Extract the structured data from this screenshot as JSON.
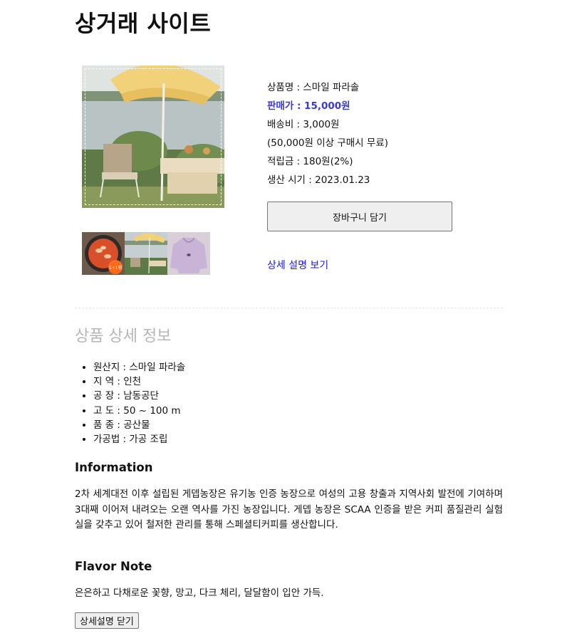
{
  "site": {
    "title": "상거래 사이트"
  },
  "product": {
    "name_line": "상품명 : 스마일 파라솔",
    "price_line": "판매가 : 15,000원",
    "shipping_line": "배송비 : 3,000원",
    "shipping_note": "(50,000원 이상 구매시 무료)",
    "points_line": "적립금 : 180원(2%)",
    "produced_line": "생산 시기 : 2023.01.23",
    "main_image": "parasol-photo",
    "thumbnails": [
      {
        "image": "tteokbokki-photo",
        "badge": "1+1행"
      },
      {
        "image": "parasol-photo"
      },
      {
        "image": "hoodie-photo"
      }
    ]
  },
  "actions": {
    "cart_label": "장바구니 담기",
    "detail_link": "상세 설명 보기",
    "close_detail": "상세설명 닫기"
  },
  "detail": {
    "title": "상품 상세 정보",
    "specs": [
      "원산지 : 스마일 파라솔",
      "지 역 : 인천",
      "공 장 : 남동공단",
      "고 도 : 50 ~ 100 m",
      "품 종 : 공산물",
      "가공법 : 가공 조립"
    ],
    "info_heading": "Information",
    "info_text": "2차 세계대전 이후 설립된 게뎁농장은 유기농 인증 농장으로 여성의 고용 창출과 지역사회 발전에 기여하며 3대째 이어져 내려오는 오랜 역사를 가진 농장입니다. 게뎁 농장은 SCAA 인증을 받은 커피 품질관리 실험실을 갖추고 있어 철저한 관리를 통해 스페셜티커피를 생산합니다.",
    "flavor_heading": "Flavor Note",
    "flavor_text": "은은하고 다채로운 꽃향, 망고, 다크 체리, 달달함이 입안 가득."
  },
  "colors": {
    "price": "#3a3ad6",
    "link": "#1a1ae6",
    "detail_title": "#b6b6b6",
    "button_bg": "#efefef"
  }
}
